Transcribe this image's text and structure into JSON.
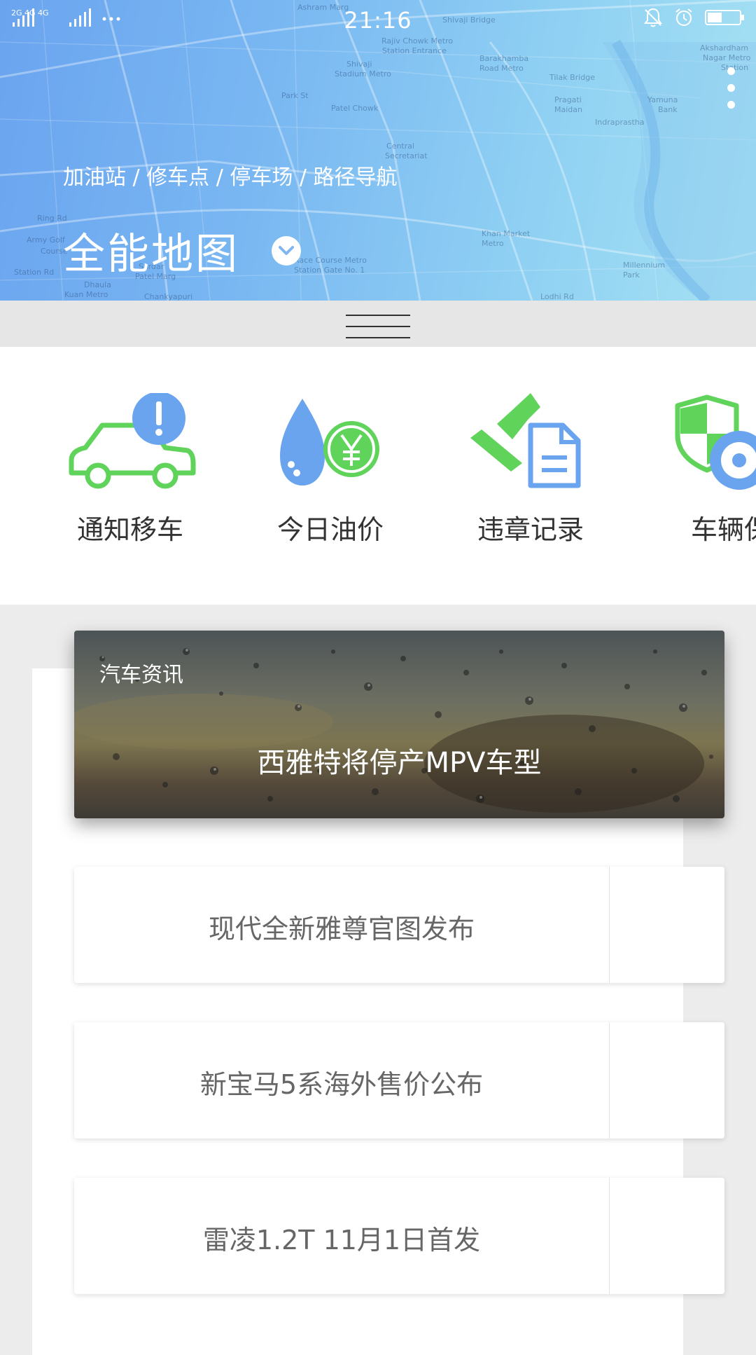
{
  "status_bar": {
    "signal_text": "2G  4G 4G",
    "time": "21:16"
  },
  "header": {
    "subtitle": "加油站 / 修车点 / 停车场 / 路径导航",
    "title": "全能地图",
    "map_labels": [
      "Ashram Marg",
      "Rajiv Chowk Metro",
      "Station Entrance",
      "Shivaji",
      "Stadium Metro",
      "Patel Chowk",
      "Park St",
      "Central",
      "Secretariat",
      "Barakhamba",
      "Road Metro",
      "Shivaji Bridge",
      "Tilak Bridge",
      "Pragati",
      "Maidan",
      "Indraprastha",
      "Yamuna",
      "Bank",
      "Ring Rd",
      "Army Golf",
      "Course",
      "Station Rd",
      "Dhaula",
      "Kuan Metro",
      "Sardar",
      "Patel Marg",
      "Chankyapuri",
      "Race Course Metro",
      "Station Gate No. 1",
      "Khan Market",
      "Metro",
      "Millennium",
      "Park",
      "Lodhi Rd",
      "Akshardham",
      "Nagar Metro",
      "Station"
    ]
  },
  "actions": [
    {
      "label": "通知移车",
      "icon": "car-alert-icon"
    },
    {
      "label": "今日油价",
      "icon": "oil-price-icon"
    },
    {
      "label": "违章记录",
      "icon": "violation-record-icon"
    },
    {
      "label": "车辆保",
      "icon": "vehicle-insurance-icon"
    }
  ],
  "news": {
    "category": "汽车资讯",
    "hero_headline": "西雅特将停产MPV车型",
    "items": [
      {
        "title": "现代全新雅尊官图发布"
      },
      {
        "title": "新宝马5系海外售价公布"
      },
      {
        "title": "雷凌1.2T 11月1日首发"
      }
    ]
  },
  "colors": {
    "header_blue": "#6aa4ef",
    "header_cyan": "#a6e2f3",
    "icon_green": "#5fd35a",
    "icon_blue": "#6aa4ef"
  }
}
